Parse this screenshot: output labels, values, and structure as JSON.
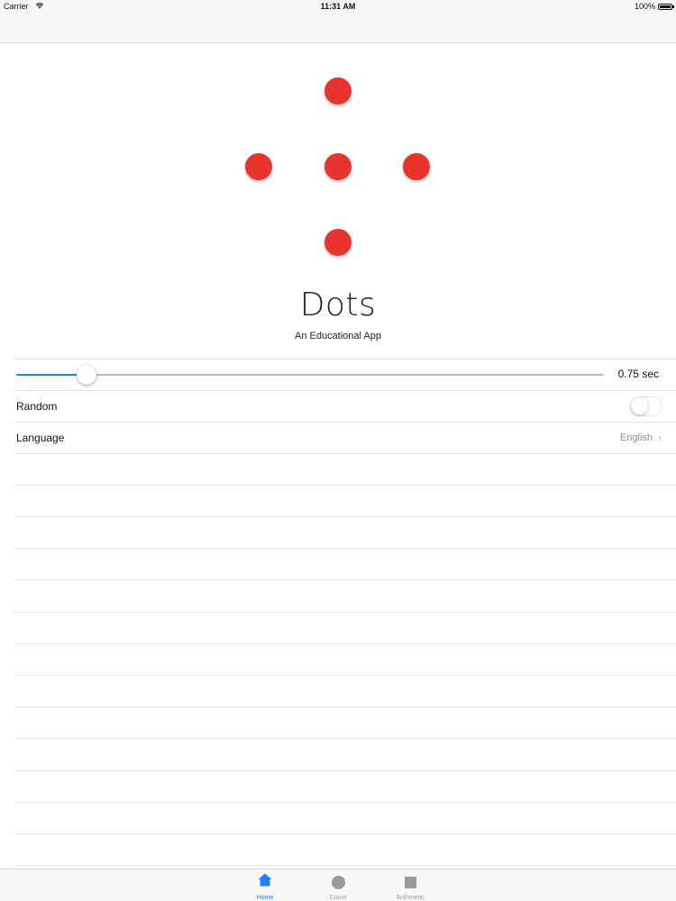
{
  "status_bar": {
    "carrier": "Carrier",
    "wifi_icon": "wifi-icon",
    "time": "11:31 AM",
    "battery": "100%"
  },
  "app": {
    "title": "Dots",
    "subtitle": "An Educational App",
    "dot_color": "#e9332e",
    "dot_count": 5
  },
  "settings": {
    "speed_slider": {
      "value_label": "0.75 sec",
      "fraction": 0.12
    },
    "random": {
      "label": "Random",
      "on": false
    },
    "language": {
      "label": "Language",
      "value": "English"
    }
  },
  "tab_bar": {
    "tabs": [
      {
        "label": "Home",
        "icon": "home-icon",
        "active": true
      },
      {
        "label": "Count",
        "icon": "circle-icon",
        "active": false
      },
      {
        "label": "Arithmetic",
        "icon": "square-icon",
        "active": false
      }
    ]
  },
  "colors": {
    "accent": "#1a83f6",
    "inactive": "#9b9b9f"
  }
}
